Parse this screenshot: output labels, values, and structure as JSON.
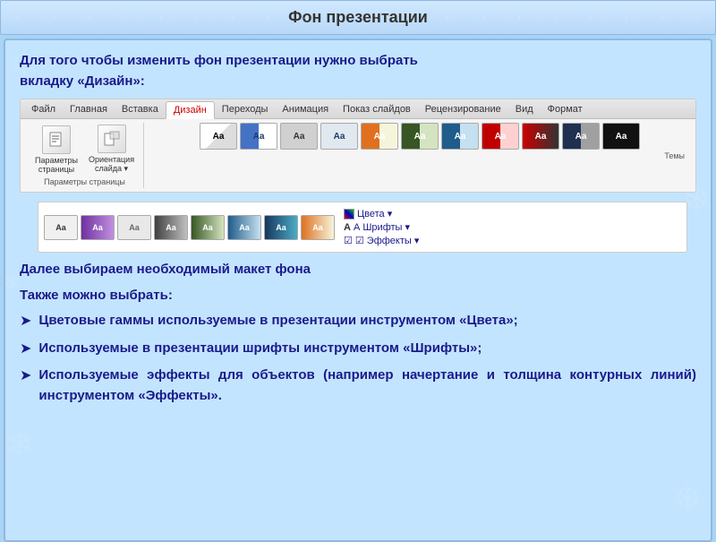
{
  "title": "Фон презентации",
  "intro": {
    "line1": "Для  того  чтобы  изменить  фон  презентации  нужно  выбрать",
    "line2": "вкладку «Дизайн»:"
  },
  "ribbon": {
    "tabs": [
      "Файл",
      "Главная",
      "Вставка",
      "Дизайн",
      "Переходы",
      "Анимация",
      "Показ слайдов",
      "Рецензирование",
      "Вид",
      "Формат"
    ],
    "active_tab": "Дизайн",
    "groups": {
      "page_setup": {
        "buttons": [
          "Параметры страницы",
          "Ориентация слайда"
        ],
        "label": "Параметры страницы"
      },
      "themes": {
        "label": "Темы"
      }
    }
  },
  "section1": "Далее выбираем необходимый макет фона",
  "section2": "Также можно выбрать:",
  "bullets": [
    {
      "text": "Цветовые   гаммы   используемые   в   презентации инструментом «Цвета»;"
    },
    {
      "text": "Используемые  в  презентации  шрифты  инструментом «Шрифты»;"
    },
    {
      "text": "Используемые  эффекты  для  объектов  (например начертание и толщина контурных линий) инструментом «Эффекты»."
    }
  ],
  "side_options": {
    "colors": "Цвета ▾",
    "fonts": "А Шрифты ▾",
    "effects": "☑ Эффекты ▾"
  }
}
